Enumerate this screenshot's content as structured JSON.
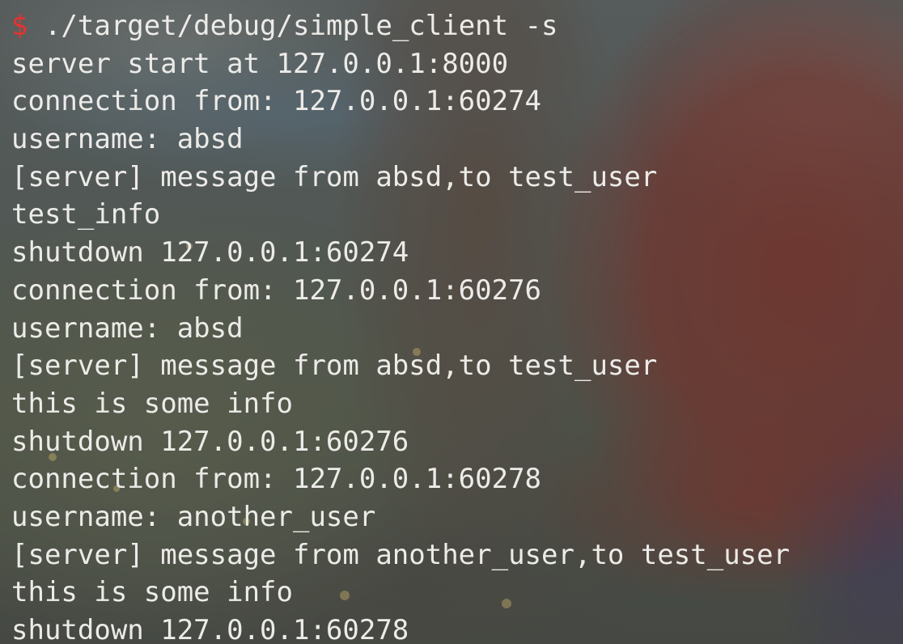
{
  "terminal": {
    "prompt_symbol": "$",
    "command": " ./target/debug/simple_client -s",
    "output_lines": [
      "server start at 127.0.0.1:8000",
      "connection from: 127.0.0.1:60274",
      "username: absd",
      "[server] message from absd,to test_user",
      "test_info",
      "shutdown 127.0.0.1:60274",
      "connection from: 127.0.0.1:60276",
      "username: absd",
      "[server] message from absd,to test_user",
      "this is some info",
      "shutdown 127.0.0.1:60276",
      "connection from: 127.0.0.1:60278",
      "username: another_user",
      "[server] message from another_user,to test_user",
      "this is some info",
      "shutdown 127.0.0.1:60278"
    ]
  },
  "colors": {
    "prompt": "#e8322f",
    "text": "#ecebe8"
  }
}
